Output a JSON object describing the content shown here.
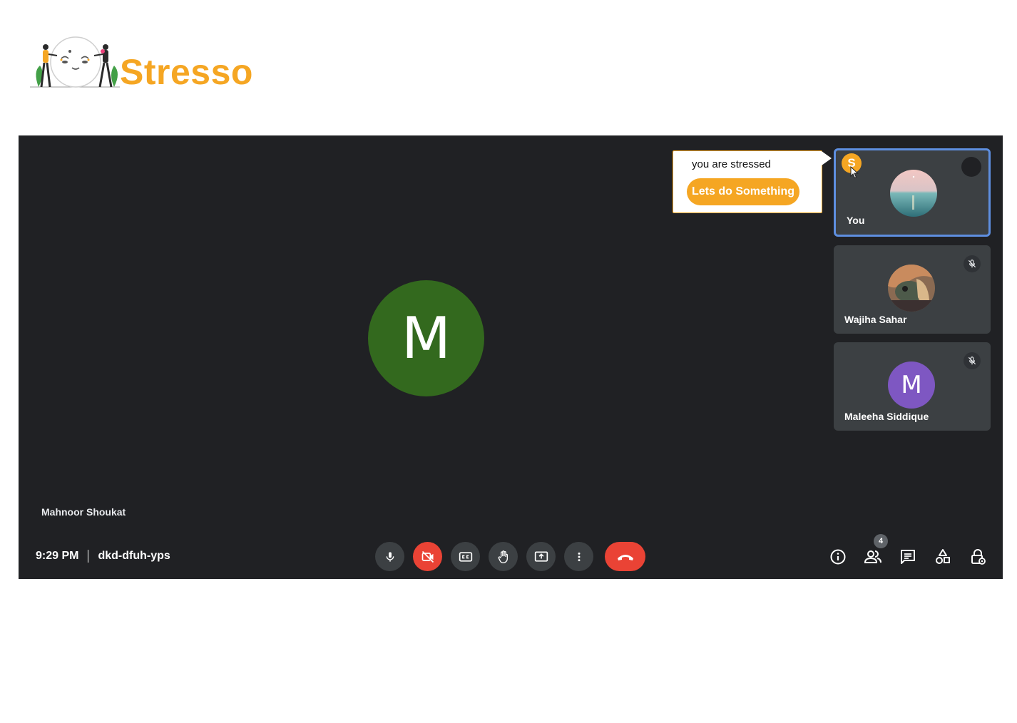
{
  "brand": {
    "name": "Stresso",
    "color": "#f5a623",
    "illustration_icon": "two-people-with-moon-face-illustration"
  },
  "meeting": {
    "main_speaker": {
      "initial": "M",
      "name": "Mahnoor Shoukat",
      "avatar_color": "#33691e"
    },
    "time": "9:29 PM",
    "code": "dkd-dfuh-yps",
    "stress_alert": {
      "message": "you are stressed",
      "cta_label": "Lets do Something",
      "badge_letter": "S"
    },
    "participants": [
      {
        "name": "You",
        "avatar": "sea-landscape-photo",
        "active": true
      },
      {
        "name": "Wajiha Sahar",
        "avatar": "animal-photo",
        "muted": true
      },
      {
        "name": "Maleeha Siddique",
        "initial": "M",
        "avatar_color": "#7e57c2",
        "muted": true
      }
    ],
    "controls": [
      "mic-icon",
      "camera-off-icon",
      "captions-icon",
      "raise-hand-icon",
      "present-screen-icon",
      "more-options-icon",
      "end-call-icon"
    ],
    "right_controls": [
      "info-icon",
      "people-icon",
      "chat-icon",
      "activities-icon",
      "host-controls-icon"
    ],
    "people_count": "4"
  },
  "colors": {
    "background": "#202124",
    "tile": "#3c4043",
    "danger": "#ea4335",
    "accent": "#f5a623",
    "active_border": "#5e8fe0"
  }
}
